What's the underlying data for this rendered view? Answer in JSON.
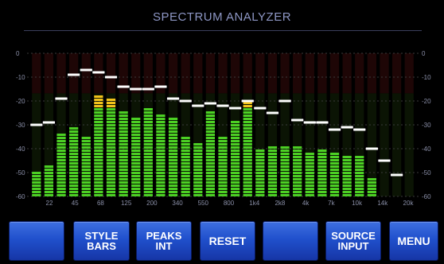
{
  "title": "SPECTRUM ANALYZER",
  "colors": {
    "background": "#000000",
    "bar_green": "#4cd024",
    "bar_peak_yellow": "#f1c21b",
    "peak_marker": "#ffffff",
    "button_blue": "#2352c9",
    "title": "#8d96c4"
  },
  "y_axis": {
    "labels": [
      "0",
      "-10",
      "-20",
      "-30",
      "-40",
      "-50",
      "-60"
    ],
    "range": [
      -60,
      0
    ]
  },
  "x_axis": {
    "labels": [
      "22",
      "45",
      "68",
      "125",
      "200",
      "340",
      "550",
      "800",
      "1k4",
      "2k8",
      "4k",
      "7k",
      "10k",
      "14k",
      "20k"
    ]
  },
  "chart_data": {
    "type": "bar",
    "ylim": [
      -60,
      0
    ],
    "bar_levels_db": [
      -49,
      -46,
      -33,
      -30,
      -34,
      -17,
      -18,
      -24,
      -26,
      -22,
      -25,
      -26,
      -35,
      -37,
      -24,
      -34,
      -28,
      -20,
      -40,
      -38,
      -39,
      -38,
      -41,
      -40,
      -41,
      -42,
      -43,
      -52
    ],
    "peak_hold_db": [
      -30,
      -29,
      -19,
      -9,
      -7,
      -8,
      -10,
      -14,
      -15,
      -15,
      -14,
      -19,
      -20,
      -22,
      -21,
      -22,
      -23,
      -20,
      -23,
      -25,
      -20,
      -28,
      -29,
      -29,
      -32,
      -31,
      -32,
      -40,
      -45,
      -51
    ]
  },
  "buttons": [
    {
      "line1": "",
      "line2": ""
    },
    {
      "line1": "STYLE",
      "line2": "BARS"
    },
    {
      "line1": "PEAKS",
      "line2": "INT"
    },
    {
      "line1": "RESET",
      "line2": ""
    },
    {
      "line1": "",
      "line2": ""
    },
    {
      "line1": "SOURCE",
      "line2": "INPUT"
    },
    {
      "line1": "MENU",
      "line2": ""
    }
  ]
}
